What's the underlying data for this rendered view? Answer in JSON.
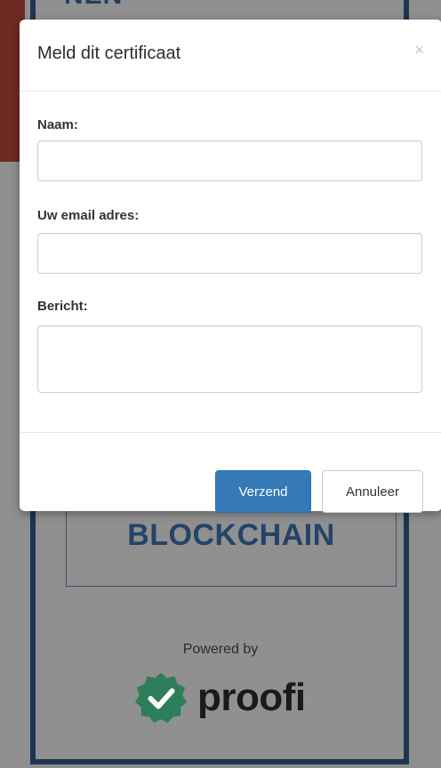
{
  "background": {
    "top_text": "NEN",
    "blockchain_label": "BLOCKCHAIN",
    "powered_by": "Powered by",
    "brand_name": "proofi",
    "brand_badge_icon": "check-badge-icon",
    "colors": {
      "frame": "#1d3550",
      "blockchain_text": "#23436a",
      "badge_green": "#2e7d5b"
    }
  },
  "modal": {
    "title": "Meld dit certificaat",
    "close_glyph": "×",
    "close_icon": "close-icon",
    "fields": {
      "name": {
        "label": "Naam:",
        "value": "",
        "placeholder": ""
      },
      "email": {
        "label": "Uw email adres:",
        "value": "",
        "placeholder": ""
      },
      "message": {
        "label": "Bericht:",
        "value": "",
        "placeholder": ""
      }
    },
    "buttons": {
      "submit": "Verzend",
      "cancel": "Annuleer"
    },
    "colors": {
      "primary": "#3479b8"
    }
  }
}
